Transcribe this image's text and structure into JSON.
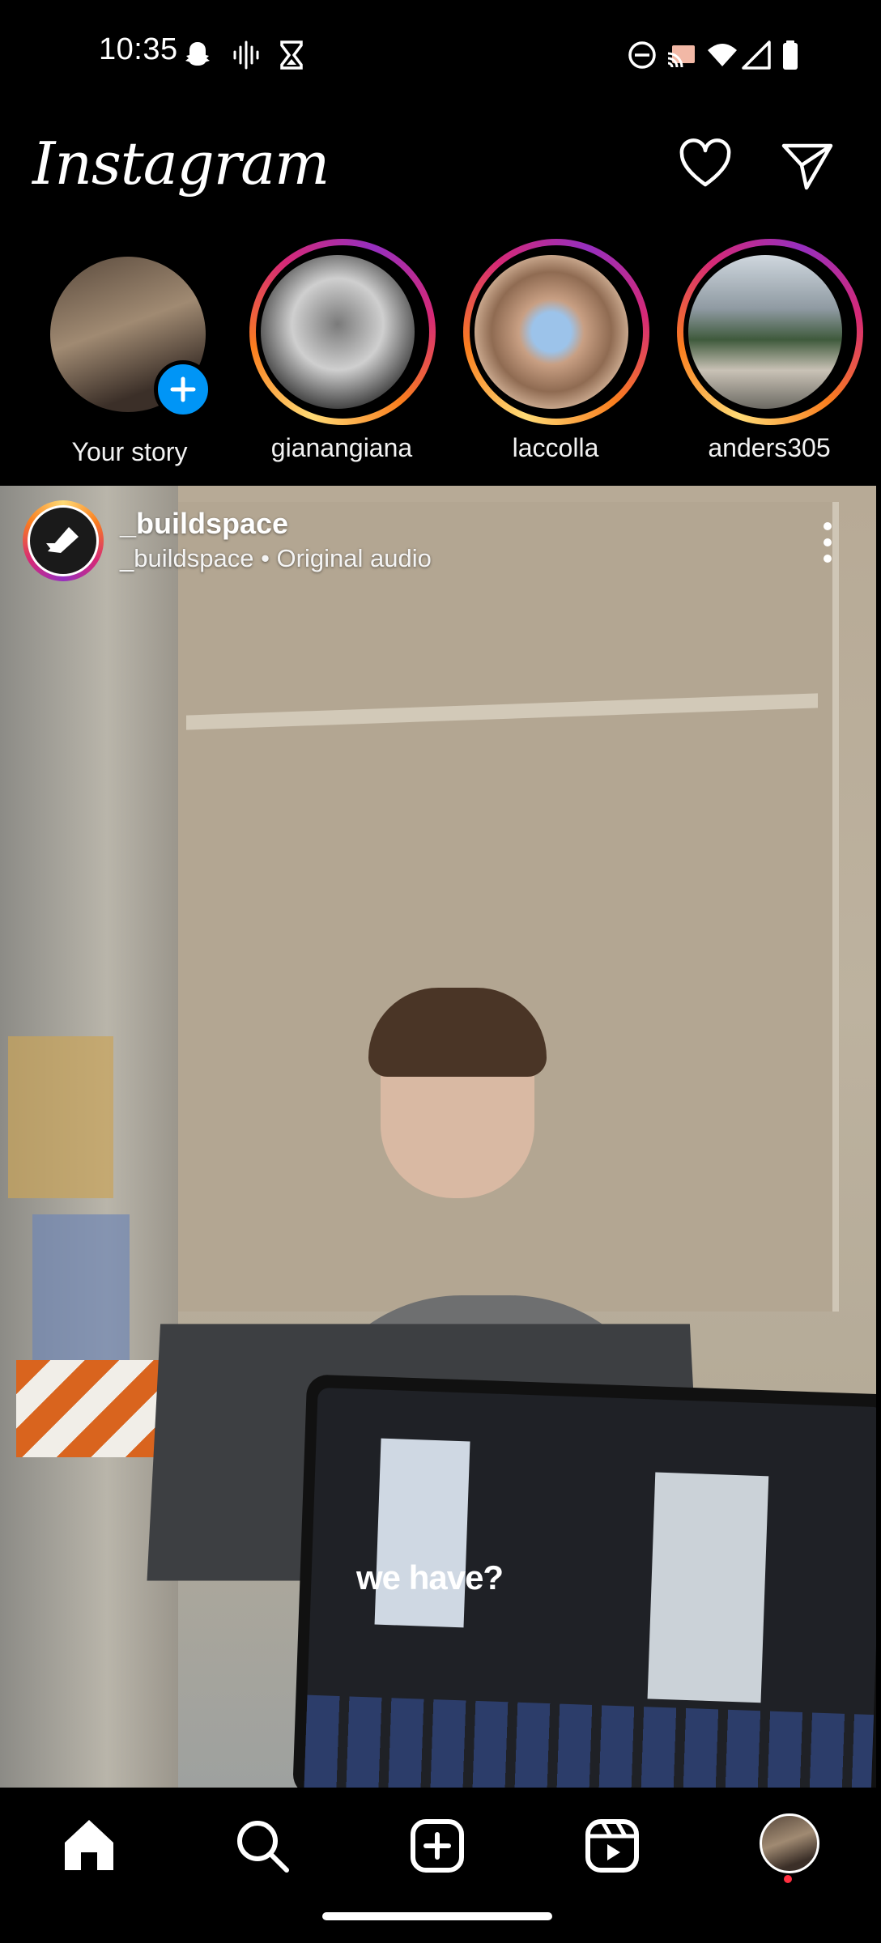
{
  "status_bar": {
    "time": "10:35",
    "left_icons": [
      "snapchat-icon",
      "audio-wave-icon",
      "hourglass-icon"
    ],
    "right_icons": [
      "do-not-disturb-icon",
      "cast-icon",
      "wifi-icon",
      "signal-icon",
      "battery-icon"
    ]
  },
  "header": {
    "logo": "Instagram",
    "icons": [
      "heart-icon",
      "send-icon"
    ]
  },
  "stories": [
    {
      "label": "Your story",
      "own": true
    },
    {
      "label": "gianangiana"
    },
    {
      "label": "laccolla"
    },
    {
      "label": "anders305"
    }
  ],
  "post": {
    "username": "_buildspace",
    "audio": "_buildspace • Original audio",
    "caption_overlay": "we have?"
  },
  "bottom_nav": {
    "items": [
      "home-icon",
      "search-icon",
      "create-icon",
      "reels-icon",
      "profile-avatar"
    ],
    "active": "home-icon",
    "notification_dot_color": "#ff3040"
  },
  "colors": {
    "background": "#000000",
    "add_story": "#0095f6"
  }
}
